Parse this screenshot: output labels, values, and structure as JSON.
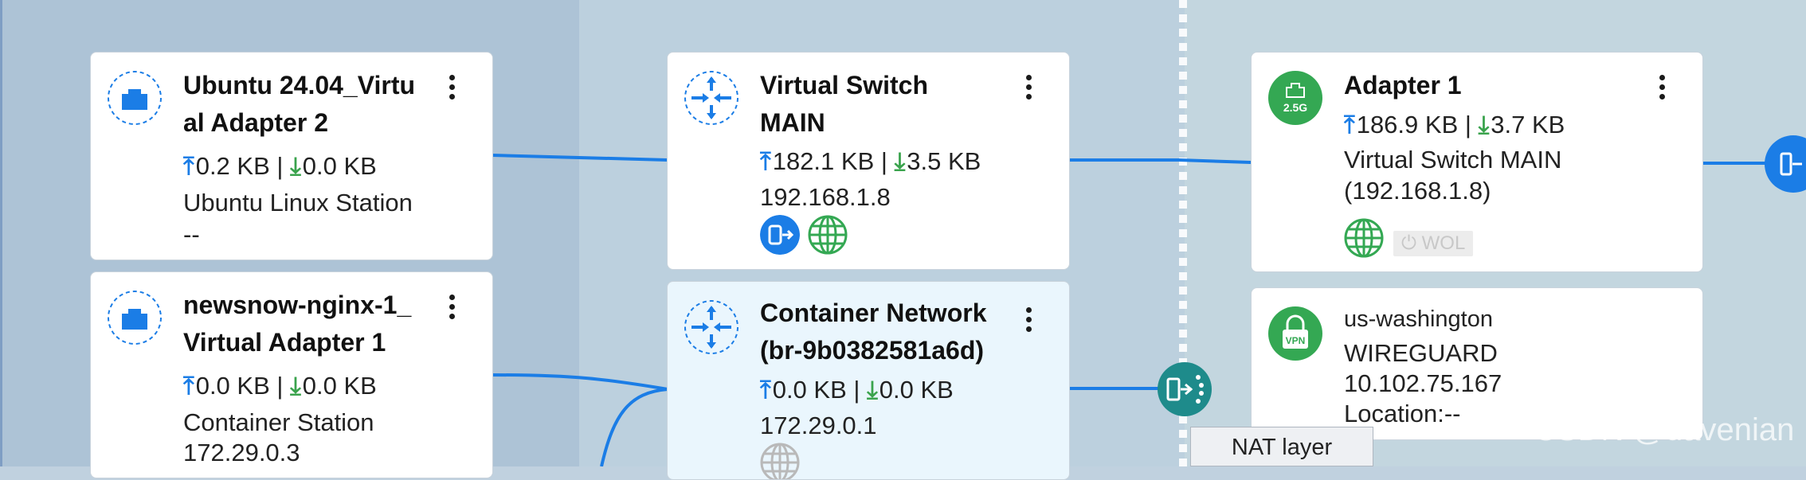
{
  "colors": {
    "accent": "#1b7de6",
    "upload": "#1b7de6",
    "download": "#3aa34d",
    "vpn": "#34a853",
    "link": "#1b7de6"
  },
  "cards": {
    "ubuntu": {
      "title_line1": "Ubuntu 24.04_Virtu",
      "title_line2": "al Adapter 2",
      "up": "0.2 KB",
      "sep": "|",
      "down": "0.0 KB",
      "detail1": "Ubuntu Linux Station",
      "detail2": "--",
      "icon": "ethernet-port-icon"
    },
    "newsnow": {
      "title_line1": "newsnow-nginx-1_",
      "title_line2": "Virtual Adapter 1",
      "up": "0.0 KB",
      "sep": "|",
      "down": "0.0 KB",
      "detail1": "Container Station",
      "detail2": "172.29.0.3",
      "icon": "ethernet-port-icon"
    },
    "vswitch": {
      "title_line1": "Virtual Switch",
      "title_line2": "MAIN",
      "up": "182.1 KB",
      "sep": "|",
      "down": "3.5 KB",
      "detail1": "192.168.1.8",
      "icon": "switch-icon"
    },
    "container": {
      "title_line1": "Container Network",
      "title_line2": "(br-9b0382581a6d)",
      "up": "0.0 KB",
      "sep": "|",
      "down": "0.0 KB",
      "detail1": "172.29.0.1",
      "icon": "switch-icon"
    },
    "adapter": {
      "title": "Adapter 1",
      "badge": "2.5G",
      "up": "186.9 KB",
      "sep": "|",
      "down": "3.7 KB",
      "detail1": "Virtual Switch MAIN",
      "detail2": "(192.168.1.8)",
      "wol": "⏻ WOL",
      "icon": "ethernet-2.5g-icon"
    },
    "vpn": {
      "title": "us-washington",
      "badge": "VPN",
      "detail1": "WIREGUARD",
      "detail2": "10.102.75.167",
      "detail3": "Location:--",
      "icon": "vpn-lock-icon"
    }
  },
  "nat_label": "NAT layer",
  "watermark": "CSDN @davenian"
}
